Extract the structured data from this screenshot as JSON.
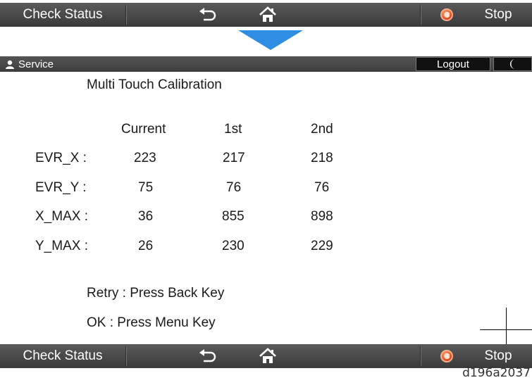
{
  "top_bar": {
    "check_status": "Check Status",
    "stop": "Stop"
  },
  "service_bar": {
    "label": "Service",
    "logout": "Logout"
  },
  "screen": {
    "title": "Multi Touch Calibration",
    "columns": [
      "Current",
      "1st",
      "2nd"
    ],
    "rows": [
      {
        "label": "EVR_X :",
        "values": [
          "223",
          "217",
          "218"
        ]
      },
      {
        "label": "EVR_Y :",
        "values": [
          "75",
          "76",
          "76"
        ]
      },
      {
        "label": "X_MAX :",
        "values": [
          "36",
          "855",
          "898"
        ]
      },
      {
        "label": "Y_MAX :",
        "values": [
          "26",
          "230",
          "229"
        ]
      }
    ],
    "retry": "Retry : Press Back Key",
    "ok": "OK : Press Menu Key"
  },
  "bottom_bar": {
    "check_status": "Check Status",
    "stop": "Stop"
  },
  "figure_id": "d196a2037",
  "icons": {
    "back": "back-arrow-icon",
    "home": "home-icon",
    "stop": "stop-icon",
    "user": "user-icon",
    "moon": "moon-icon"
  },
  "colors": {
    "arrow": "#2f8de4",
    "stop": "#e0481a",
    "bar": "#444444"
  }
}
